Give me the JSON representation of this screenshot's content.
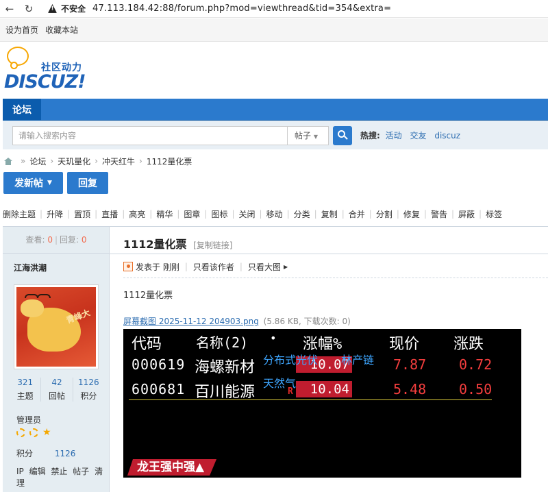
{
  "browser": {
    "back_icon": "arrow-left",
    "reload_icon": "reload",
    "security_label": "不安全",
    "url": "47.113.184.42:88/forum.php?mod=viewthread&tid=354&extra="
  },
  "toplinks": [
    "设为首页",
    "收藏本站"
  ],
  "logo": {
    "sub": "社区动力",
    "main": "DISCUZ!"
  },
  "nav": {
    "tab": "论坛"
  },
  "search": {
    "placeholder": "请输入搜索内容",
    "type": "帖子",
    "hot_label": "热搜:",
    "hot_items": [
      "活动",
      "交友",
      "discuz"
    ]
  },
  "breadcrumb": [
    "论坛",
    "天玑量化",
    "冲天红牛",
    "1112量化票"
  ],
  "actions": {
    "post": "发新帖",
    "reply": "回复"
  },
  "mod_tools": [
    "删除主题",
    "升降",
    "置顶",
    "直播",
    "高亮",
    "精华",
    "图章",
    "图标",
    "关闭",
    "移动",
    "分类",
    "复制",
    "合并",
    "分割",
    "修复",
    "警告",
    "屏蔽",
    "标签"
  ],
  "sidebar": {
    "view_label": "查看:",
    "view_count": "0",
    "reply_label": "回复:",
    "reply_count": "0",
    "author": "江海洪潮",
    "avatar_text": "青峰大",
    "stats": [
      {
        "value": "321",
        "label": "主题"
      },
      {
        "value": "42",
        "label": "回帖"
      },
      {
        "value": "1126",
        "label": "积分"
      }
    ],
    "role": "管理员",
    "score_label": "积分",
    "score_value": "1126",
    "admin_links": [
      "IP",
      "编辑",
      "禁止",
      "帖子",
      "清理"
    ]
  },
  "post": {
    "title": "1112量化票",
    "copy_link": "[复制链接]",
    "posted": "发表于 刚刚",
    "only_author": "只看该作者",
    "big_image": "只看大图",
    "body": "1112量化票",
    "attachment": {
      "name": "屏幕截图 2025-11-12 204903.png",
      "info": "(5.86 KB, 下载次数: 0)"
    }
  },
  "screenshot": {
    "headers": [
      "代码",
      "名称(2)",
      "•",
      "涨幅%",
      "现价",
      "涨跌"
    ],
    "rows": [
      {
        "code": "000619",
        "name": "海螺新材",
        "change_pct": "10.07",
        "price": "7.87",
        "change": "0.72",
        "tag1": "分布式光伏",
        "tag2": "林产链",
        "mark": ""
      },
      {
        "code": "600681",
        "name": "百川能源",
        "change_pct": "10.04",
        "price": "5.48",
        "change": "0.50",
        "tag1": "天然气",
        "tag2": "",
        "mark": "R"
      }
    ],
    "banner": "龙王强中强▲"
  }
}
